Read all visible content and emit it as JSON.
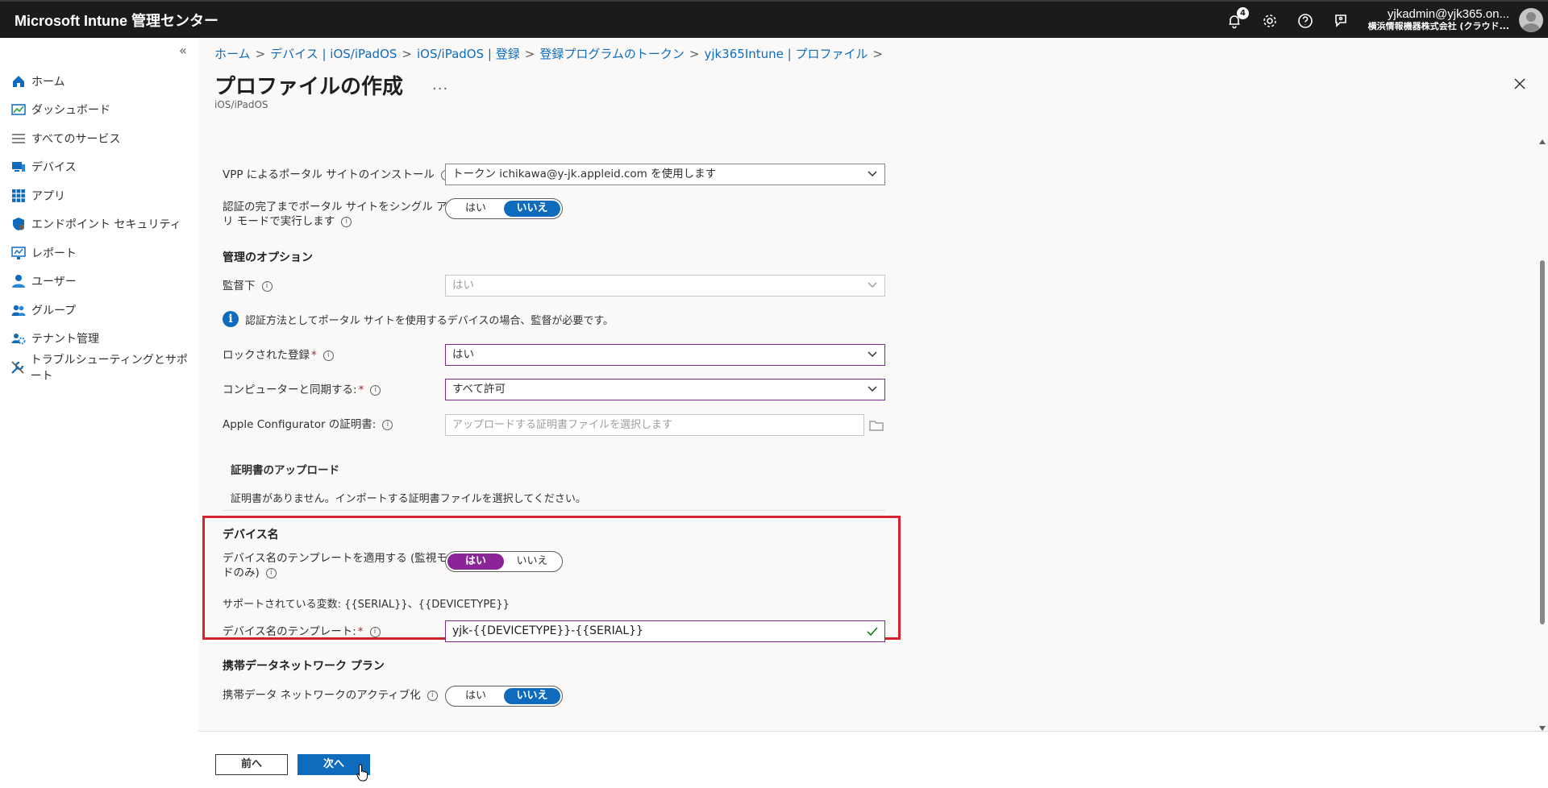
{
  "topbar": {
    "brand": "Microsoft Intune 管理センター",
    "notification_count": "4",
    "user_name": "yjkadmin@yjk365.on...",
    "user_org": "横浜情報機器株式会社 (クラウド..."
  },
  "sidebar": {
    "collapse_glyph": "«",
    "items": [
      {
        "label": "ホーム",
        "icon": "home-icon"
      },
      {
        "label": "ダッシュボード",
        "icon": "dashboard-icon"
      },
      {
        "label": "すべてのサービス",
        "icon": "list-icon"
      },
      {
        "label": "デバイス",
        "icon": "devices-icon"
      },
      {
        "label": "アプリ",
        "icon": "apps-icon"
      },
      {
        "label": "エンドポイント セキュリティ",
        "icon": "shield-icon"
      },
      {
        "label": "レポート",
        "icon": "reports-icon"
      },
      {
        "label": "ユーザー",
        "icon": "user-icon"
      },
      {
        "label": "グループ",
        "icon": "group-icon"
      },
      {
        "label": "テナント管理",
        "icon": "tenant-icon"
      },
      {
        "label": "トラブルシューティングとサポート",
        "icon": "wrench-icon"
      }
    ]
  },
  "header": {
    "breadcrumb": [
      "ホーム",
      "デバイス | iOS/iPadOS",
      "iOS/iPadOS | 登録",
      "登録プログラムのトークン",
      "yjk365Intune | プロファイル"
    ],
    "title": "プロファイルの作成",
    "more": "...",
    "subtitle": "iOS/iPadOS"
  },
  "form": {
    "vpp_label": "VPP によるポータル サイトのインストール",
    "vpp_value": "トークン ichikawa@y-jk.appleid.com を使用します",
    "single_app_label_1": "認証の完了までポータル サイトをシングル アプ",
    "single_app_label_2": "リ モードで実行します",
    "yes": "はい",
    "no": "いいえ",
    "mgmt_section": "管理のオプション",
    "supervised_label": "監督下",
    "supervised_value": "はい",
    "supervised_notice": "認証方法としてポータル サイトを使用するデバイスの場合、監督が必要です。",
    "locked_label": "ロックされた登録",
    "locked_value": "はい",
    "sync_label": "コンピューターと同期する:",
    "sync_value": "すべて許可",
    "apple_cfg_label": "Apple Configurator の証明書:",
    "apple_cfg_placeholder": "アップロードする証明書ファイルを選択します",
    "cert_section": "証明書のアップロード",
    "cert_none": "証明書がありません。インポートする証明書ファイルを選択してください。",
    "device_name_section": "デバイス名",
    "apply_template_label_1": "デバイス名のテンプレートを適用する (監視モー",
    "apply_template_label_2": "ドのみ)",
    "supported_vars": "サポートされている変数: {{SERIAL}}、{{DEVICETYPE}}",
    "template_label": "デバイス名のテンプレート:",
    "template_value": "yjk-{{DEVICETYPE}}-{{SERIAL}}",
    "cellular_section": "携帯データネットワーク プラン",
    "cellular_label": "携帯データ ネットワークのアクティブ化"
  },
  "footer": {
    "prev": "前へ",
    "next": "次へ"
  },
  "colors": {
    "accent_blue": "#0f6cbd",
    "accent_purple": "#8b2597",
    "highlight_red": "#d1242f",
    "topbar": "#1b1b1b"
  }
}
